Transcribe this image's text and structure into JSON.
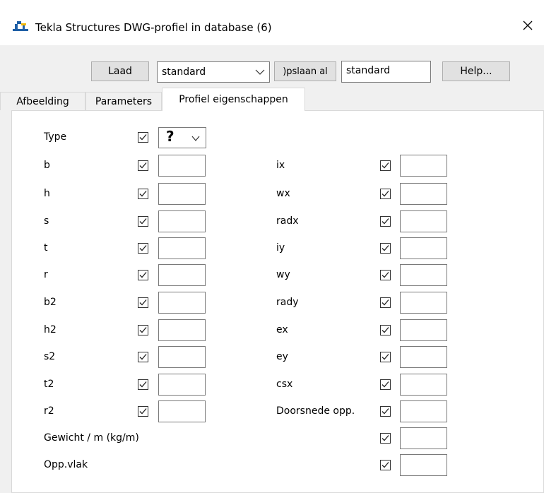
{
  "window": {
    "title": "Tekla Structures  DWG-profiel in database (6)",
    "close_glyph": "✕",
    "app_icon": "tekla-logo-icon"
  },
  "toolbar": {
    "load_label": "Laad",
    "preset_combo_value": "standard",
    "save_as_label": ")pslaan al",
    "save_as_value": "standard",
    "help_label": "Help..."
  },
  "tabs": [
    {
      "label": "Afbeelding",
      "active": false
    },
    {
      "label": "Parameters",
      "active": false
    },
    {
      "label": "Profiel eigenschappen",
      "active": true
    }
  ],
  "type_row": {
    "label": "Type",
    "checked": true,
    "value": "?"
  },
  "left_fields": [
    {
      "label": "b",
      "checked": true,
      "value": ""
    },
    {
      "label": "h",
      "checked": true,
      "value": ""
    },
    {
      "label": "s",
      "checked": true,
      "value": ""
    },
    {
      "label": "t",
      "checked": true,
      "value": ""
    },
    {
      "label": "r",
      "checked": true,
      "value": ""
    },
    {
      "label": "b2",
      "checked": true,
      "value": ""
    },
    {
      "label": "h2",
      "checked": true,
      "value": ""
    },
    {
      "label": "s2",
      "checked": true,
      "value": ""
    },
    {
      "label": "t2",
      "checked": true,
      "value": ""
    },
    {
      "label": "r2",
      "checked": true,
      "value": ""
    }
  ],
  "right_fields": [
    {
      "label": "ix",
      "checked": true,
      "value": ""
    },
    {
      "label": "wx",
      "checked": true,
      "value": ""
    },
    {
      "label": "radx",
      "checked": true,
      "value": ""
    },
    {
      "label": "iy",
      "checked": true,
      "value": ""
    },
    {
      "label": "wy",
      "checked": true,
      "value": ""
    },
    {
      "label": "rady",
      "checked": true,
      "value": ""
    },
    {
      "label": "ex",
      "checked": true,
      "value": ""
    },
    {
      "label": "ey",
      "checked": true,
      "value": ""
    },
    {
      "label": "csx",
      "checked": true,
      "value": ""
    },
    {
      "label": "Doorsnede opp.",
      "checked": true,
      "value": ""
    }
  ],
  "bottom_fields": [
    {
      "label": "Gewicht / m (kg/m)",
      "checked": true,
      "value": ""
    },
    {
      "label": "Opp.vlak",
      "checked": true,
      "value": ""
    }
  ],
  "colors": {
    "window_bg": "#f0f0f0",
    "panel_bg": "#ffffff",
    "button_bg": "#e1e1e1",
    "logo_blue": "#1f5fa6",
    "logo_yellow": "#f2b705"
  }
}
